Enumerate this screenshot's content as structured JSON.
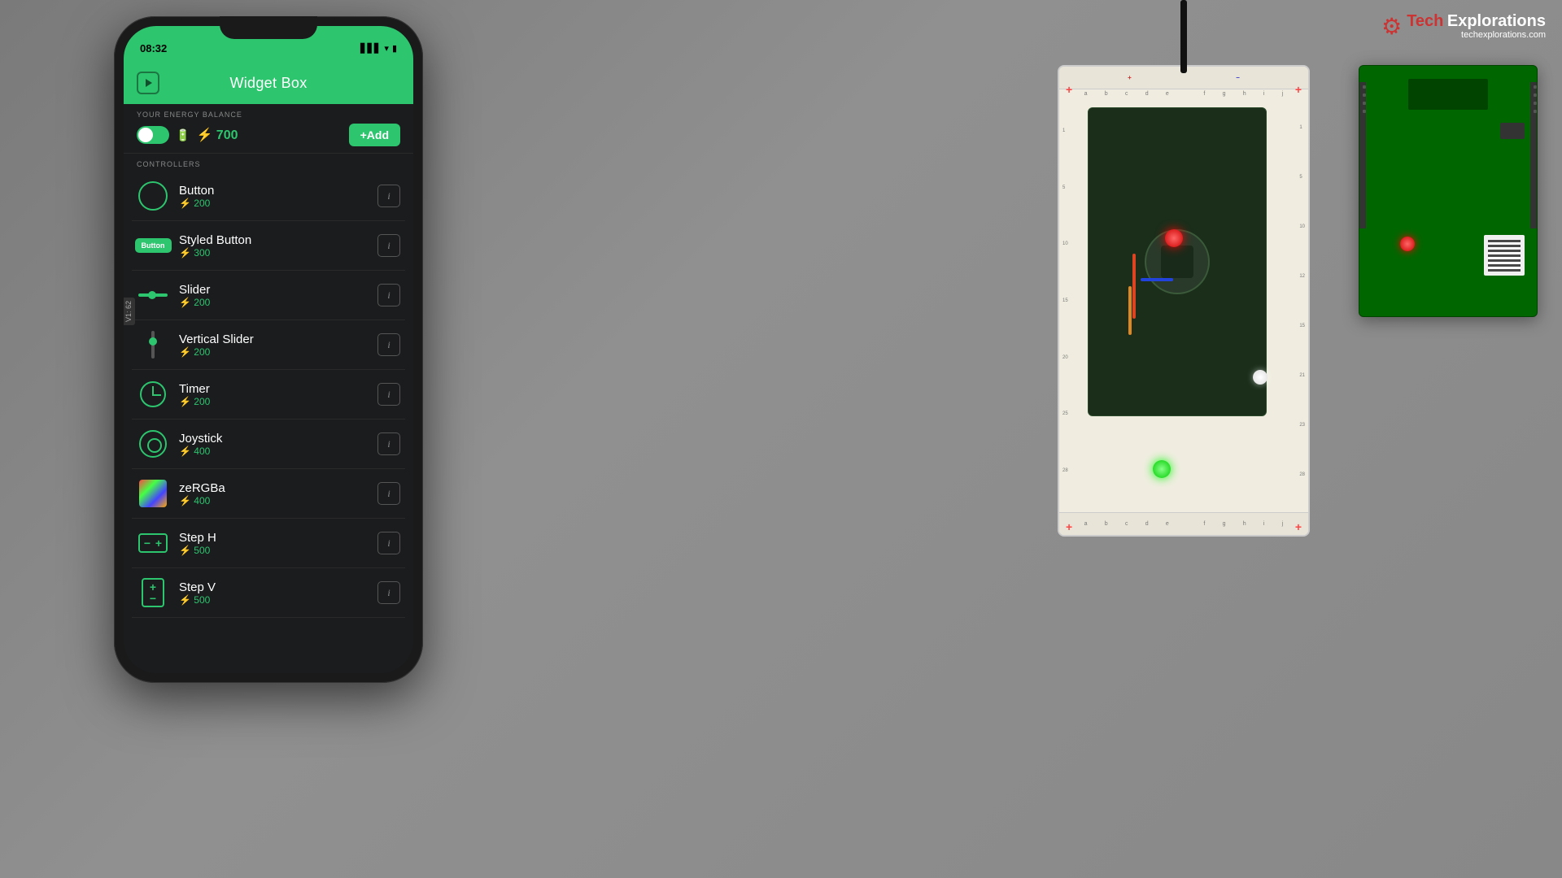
{
  "background": {
    "color": "#8a8a8a"
  },
  "logo": {
    "gear_symbol": "⚙",
    "tech_text": "Tech",
    "explorations_text": "Explorations",
    "url": "techexplorations.com"
  },
  "phone": {
    "status_bar": {
      "time": "08:32",
      "signal": "▋▋▋",
      "wifi": "wifi",
      "battery": "🔋"
    },
    "header": {
      "title": "Widget Box",
      "play_button_label": "▶"
    },
    "energy": {
      "section_label": "YOUR ENERGY BALANCE",
      "value": "⚡ 700",
      "add_button": "+Add"
    },
    "controllers": {
      "section_label": "CONTROLLERS"
    },
    "version_badge": "V1: 62",
    "widgets": [
      {
        "name": "Button",
        "cost": "⚡ 200",
        "icon_type": "circle",
        "info": "i"
      },
      {
        "name": "Styled Button",
        "cost": "⚡ 300",
        "icon_type": "styled-btn",
        "info": "i"
      },
      {
        "name": "Slider",
        "cost": "⚡ 200",
        "icon_type": "slider",
        "info": "i"
      },
      {
        "name": "Vertical Slider",
        "cost": "⚡ 200",
        "icon_type": "vslider",
        "info": "i"
      },
      {
        "name": "Timer",
        "cost": "⚡ 200",
        "icon_type": "timer",
        "info": "i"
      },
      {
        "name": "Joystick",
        "cost": "⚡ 400",
        "icon_type": "joystick",
        "info": "i"
      },
      {
        "name": "zeRGBa",
        "cost": "⚡ 400",
        "icon_type": "zergba",
        "info": "i"
      },
      {
        "name": "Step H",
        "cost": "⚡ 500",
        "icon_type": "step-h",
        "info": "i"
      },
      {
        "name": "Step V",
        "cost": "⚡ 500",
        "icon_type": "step-v",
        "info": "i"
      }
    ]
  }
}
